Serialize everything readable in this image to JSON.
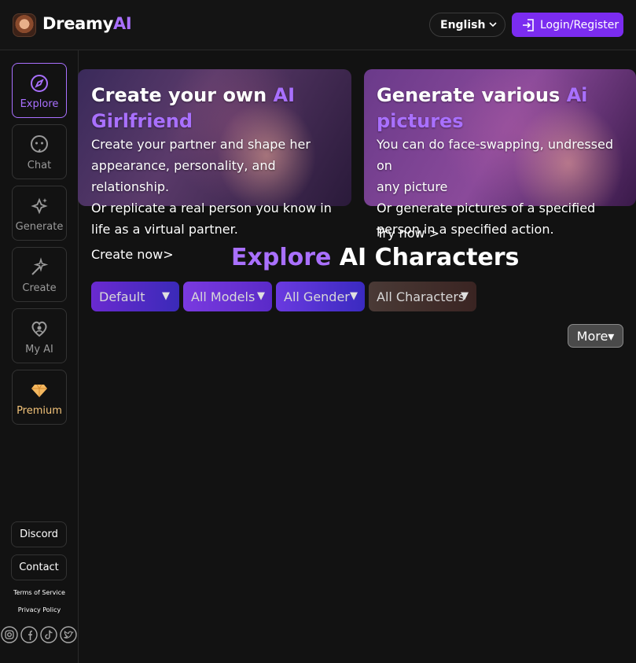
{
  "header": {
    "brand_main": "Dreamy",
    "brand_accent": "AI",
    "language": "English",
    "login_label": "Login/Register"
  },
  "sidebar": {
    "items": [
      {
        "label": "Explore",
        "icon": "compass-icon",
        "active": true
      },
      {
        "label": "Chat",
        "icon": "chat-bubble-icon"
      },
      {
        "label": "Generate",
        "icon": "sparkle-icon"
      },
      {
        "label": "Create",
        "icon": "magic-wand-icon"
      },
      {
        "label": "My AI",
        "icon": "heart-person-icon"
      },
      {
        "label": "Premium",
        "icon": "diamond-icon"
      }
    ],
    "discord_label": "Discord",
    "contact_label": "Contact",
    "terms_label": "Terms of Service",
    "privacy_label": "Privacy Policy",
    "socials": [
      "instagram-icon",
      "facebook-icon",
      "tiktok-icon",
      "twitter-icon"
    ]
  },
  "promos": [
    {
      "title_main": "Create your own ",
      "title_accent_1": "AI",
      "title_accent_2": "Girlfriend",
      "desc_lines": [
        "Create your partner and shape her",
        "appearance, personality, and",
        "relationship.",
        "Or replicate a real person you know in",
        "life as a virtual partner."
      ],
      "cta": "Create now>"
    },
    {
      "title_main": "Generate various ",
      "title_accent_1": "Ai",
      "title_accent_2": "pictures",
      "desc_lines": [
        "You can do face-swapping, undressed on",
        "any picture",
        "Or generate pictures of a specified",
        "person in a specified action."
      ],
      "cta": "Try now >"
    }
  ],
  "explore": {
    "heading_accent": "Explore",
    "heading_rest": " AI Characters",
    "filters": [
      "Default",
      "All Models",
      "All Gender",
      "All Characters"
    ],
    "more_label": "More▾"
  },
  "colors": {
    "accent": "#a970ff",
    "login_bg": "#7b2cf0",
    "premium": "#f4c47a",
    "background": "#121212"
  }
}
